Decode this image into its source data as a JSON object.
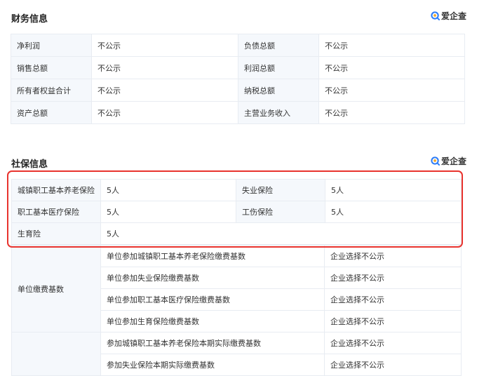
{
  "colors": {
    "highlight": "#e8332e",
    "label_bg": "#f5f8fc",
    "border": "#e8ecf2",
    "brand_blue": "#2f7df6"
  },
  "finance": {
    "title": "财务信息",
    "brand": "爱企查",
    "rows": [
      {
        "l1": "净利润",
        "v1": "不公示",
        "l2": "负债总额",
        "v2": "不公示"
      },
      {
        "l1": "销售总额",
        "v1": "不公示",
        "l2": "利润总额",
        "v2": "不公示"
      },
      {
        "l1": "所有者权益合计",
        "v1": "不公示",
        "l2": "纳税总额",
        "v2": "不公示"
      },
      {
        "l1": "资产总额",
        "v1": "不公示",
        "l2": "主营业务收入",
        "v2": "不公示"
      }
    ]
  },
  "social": {
    "title": "社保信息",
    "brand": "爱企查",
    "rows": [
      {
        "l1": "城镇职工基本养老保险",
        "v1": "5人",
        "l2": "失业保险",
        "v2": "5人"
      },
      {
        "l1": "职工基本医疗保险",
        "v1": "5人",
        "l2": "工伤保险",
        "v2": "5人"
      },
      {
        "l1": "生育险",
        "v1": "5人"
      }
    ],
    "payment": {
      "group_label": "单位缴费基数",
      "rows": [
        {
          "item": "单位参加城镇职工基本养老保险缴费基数",
          "value": "企业选择不公示"
        },
        {
          "item": "单位参加失业保险缴费基数",
          "value": "企业选择不公示"
        },
        {
          "item": "单位参加职工基本医疗保险缴费基数",
          "value": "企业选择不公示"
        },
        {
          "item": "单位参加生育保险缴费基数",
          "value": "企业选择不公示"
        },
        {
          "item": "参加城镇职工基本养老保险本期实际缴费基数",
          "value": "企业选择不公示"
        },
        {
          "item": "参加失业保险本期实际缴费基数",
          "value": "企业选择不公示"
        }
      ]
    }
  }
}
